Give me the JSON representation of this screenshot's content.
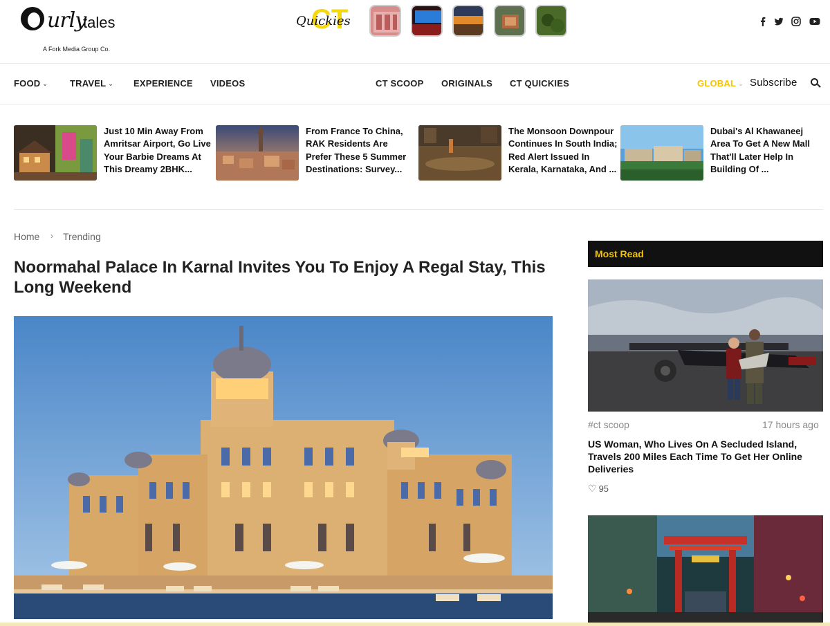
{
  "brand": {
    "logo_word": "urly",
    "logo_tales": "tales",
    "logo_sub": "A Fork Media Group Co.",
    "quickies_ct": "CT",
    "quickies_word": "Quickies",
    "accent": "#f5c400"
  },
  "social": [
    "f",
    "t",
    "ig",
    "yt"
  ],
  "nav": {
    "left": [
      {
        "label": "FOOD",
        "has_dropdown": true
      },
      {
        "label": "TRAVEL",
        "has_dropdown": true
      },
      {
        "label": "EXPERIENCE",
        "has_dropdown": false
      },
      {
        "label": "VIDEOS",
        "has_dropdown": false
      }
    ],
    "center": [
      {
        "label": "CT SCOOP"
      },
      {
        "label": "ORIGINALS"
      },
      {
        "label": "CT QUICKIES"
      }
    ],
    "global_label": "GLOBAL",
    "subscribe_label": "Subscribe"
  },
  "trending": [
    {
      "title": "Just 10 Min Away From Amritsar Airport, Go Live Your Barbie Dreams At This Dreamy 2BHK..."
    },
    {
      "title": "From France To China, RAK Residents Are Prefer These 5 Summer Destinations: Survey..."
    },
    {
      "title": "The Monsoon Downpour Continues In South India; Red Alert Issued In Kerala, Karnataka, And ..."
    },
    {
      "title": "Dubai's Al Khawaneej Area To Get A New Mall That'll Later Help In Building Of ..."
    }
  ],
  "breadcrumb": {
    "home": "Home",
    "separator": "›",
    "current": "Trending"
  },
  "article": {
    "headline": "Noormahal Palace In Karnal Invites You To Enjoy A Regal Stay, This Long Weekend"
  },
  "sidebar": {
    "heading": "Most Read",
    "item": {
      "tag": "#ct scoop",
      "time": "17 hours ago",
      "title": "US Woman, Who Lives On A Secluded Island, Travels 200 Miles Each Time To Get Her Online Deliveries",
      "likes": "95"
    }
  }
}
